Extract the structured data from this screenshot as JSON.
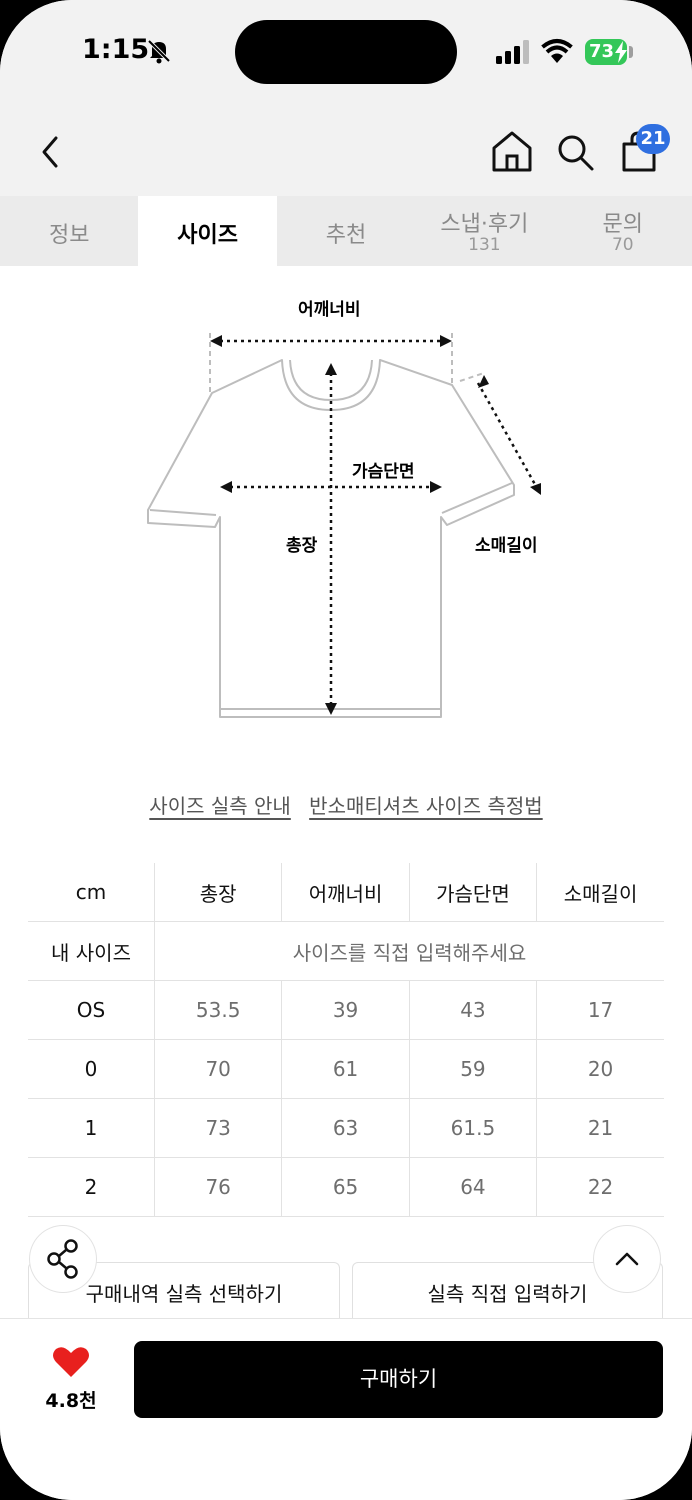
{
  "status_bar": {
    "time": "1:15",
    "battery": "73"
  },
  "nav": {
    "cart_count": "21"
  },
  "tabs": [
    {
      "label": "정보",
      "sub": ""
    },
    {
      "label": "사이즈",
      "sub": ""
    },
    {
      "label": "추천",
      "sub": ""
    },
    {
      "label": "스냅·후기",
      "sub": "131"
    },
    {
      "label": "문의",
      "sub": "70"
    }
  ],
  "diagram": {
    "shoulder": "어깨너비",
    "chest": "가슴단면",
    "length": "총장",
    "sleeve": "소매길이"
  },
  "links": {
    "guide": "사이즈 실측 안내",
    "method": "반소매티셔츠 사이즈 측정법"
  },
  "size_table": {
    "headers": [
      "cm",
      "총장",
      "어깨너비",
      "가슴단면",
      "소매길이"
    ],
    "my_size_label": "내 사이즈",
    "my_size_prompt": "사이즈를 직접 입력해주세요",
    "rows": [
      {
        "size": "OS",
        "values": [
          "53.5",
          "39",
          "43",
          "17"
        ]
      },
      {
        "size": "0",
        "values": [
          "70",
          "61",
          "59",
          "20"
        ]
      },
      {
        "size": "1",
        "values": [
          "73",
          "63",
          "61.5",
          "21"
        ]
      },
      {
        "size": "2",
        "values": [
          "76",
          "65",
          "64",
          "22"
        ]
      }
    ]
  },
  "actions": {
    "select_history": "구매내역 실측 선택하기",
    "direct_input": "실측 직접 입력하기"
  },
  "bottom": {
    "likes": "4.8천",
    "buy": "구매하기"
  },
  "colors": {
    "accent": "#2f6fe0",
    "heart": "#e8201e",
    "battery": "#34c759"
  }
}
